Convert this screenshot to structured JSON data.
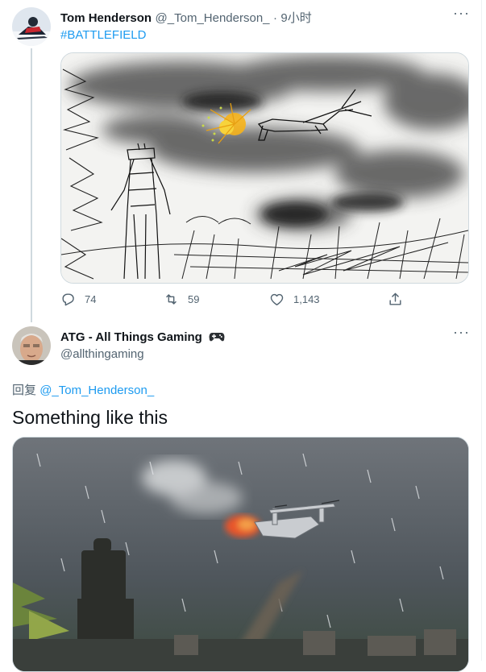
{
  "tweet1": {
    "author_name": "Tom Henderson",
    "handle": "@_Tom_Henderson_",
    "separator": "·",
    "time": "9小时",
    "hashtag": "#BATTLEFIELD",
    "replies": "74",
    "retweets": "59",
    "likes": "1,143",
    "more": "···"
  },
  "tweet2": {
    "author_name": "ATG - All Things Gaming",
    "handle": "@allthingaming",
    "reply_prefix": "回复",
    "reply_to": "@_Tom_Henderson_",
    "text": "Something like this",
    "more": "···"
  },
  "colors": {
    "link": "#1d9bf0",
    "muted": "#536471",
    "text": "#0f1419",
    "border": "#cfd9de"
  },
  "icons": [
    "reply-icon",
    "retweet-icon",
    "like-icon",
    "share-icon",
    "more-icon",
    "gamepad-icon"
  ]
}
